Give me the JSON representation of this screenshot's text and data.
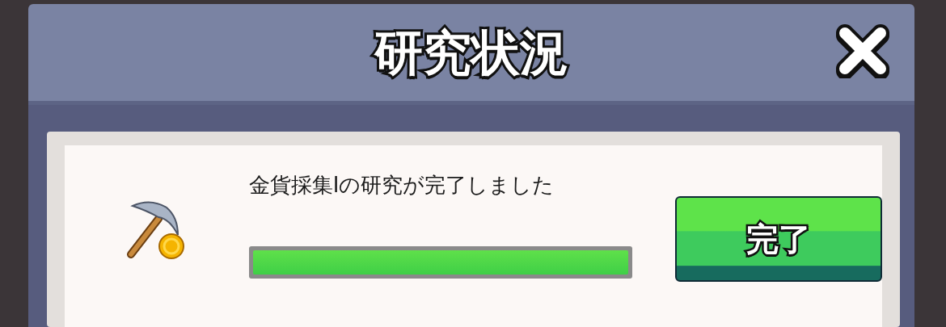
{
  "dialog": {
    "title": "研究状況"
  },
  "research": {
    "message": "金貨採集Iの研究が完了しました",
    "level": 1
  },
  "buttons": [
    {
      "label": "完了"
    }
  ]
}
